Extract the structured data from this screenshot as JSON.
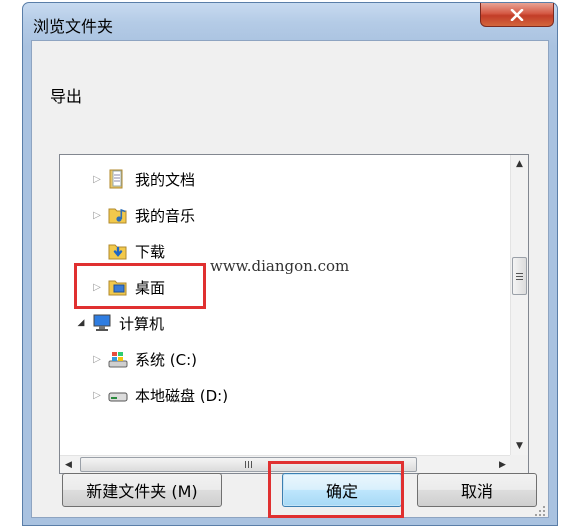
{
  "dialog": {
    "title": "浏览文件夹",
    "description": "导出",
    "close_icon": "close-icon"
  },
  "tree": {
    "items": [
      {
        "label": "我的文档",
        "icon": "documents-folder-icon",
        "expander": "collapsed"
      },
      {
        "label": "我的音乐",
        "icon": "music-folder-icon",
        "expander": "collapsed"
      },
      {
        "label": "下载",
        "icon": "downloads-folder-icon",
        "expander": "none"
      },
      {
        "label": "桌面",
        "icon": "desktop-folder-icon",
        "expander": "collapsed",
        "selected": true
      },
      {
        "label": "计算机",
        "icon": "computer-icon",
        "expander": "expanded"
      },
      {
        "label": "系统 (C:)",
        "icon": "system-drive-icon",
        "expander": "collapsed"
      },
      {
        "label": "本地磁盘 (D:)",
        "icon": "local-disk-icon",
        "expander": "collapsed"
      }
    ],
    "hscroll_thumb_glyph": "III"
  },
  "buttons": {
    "new_folder": "新建文件夹 (M)",
    "ok": "确定",
    "cancel": "取消"
  },
  "watermark": "www.diangon.com",
  "colors": {
    "highlight": "#e03030",
    "close_button": "#c9483a",
    "title_bar": "#b4cbe6",
    "default_button": "#bee6fd"
  }
}
